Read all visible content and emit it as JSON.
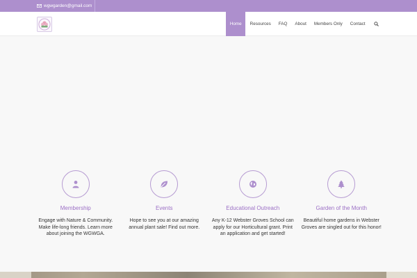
{
  "topbar": {
    "email": "wgwgarden@gmail.com",
    "icon": "mail-icon"
  },
  "header": {
    "logo_icon": "flower-logo",
    "nav": [
      {
        "label": "Home",
        "active": true
      },
      {
        "label": "Resources",
        "active": false
      },
      {
        "label": "FAQ",
        "active": false
      },
      {
        "label": "About",
        "active": false
      },
      {
        "label": "Members Only",
        "active": false
      },
      {
        "label": "Contact",
        "active": false
      }
    ],
    "search_icon": "search-icon"
  },
  "features": [
    {
      "icon": "user-icon",
      "title": "Membership",
      "description": "Engage with Nature & Community. Make life-long friends. Learn more about joining the WGWGA."
    },
    {
      "icon": "leaf-icon",
      "title": "Events",
      "description": "Hope to see you at our amazing annual plant sale! Find out more."
    },
    {
      "icon": "globe-icon",
      "title": "Educational Outreach",
      "description": "Any K-12 Webster Groves School can apply for our Horticultural grant. Print an application and get started!"
    },
    {
      "icon": "tree-icon",
      "title": "Garden of the Month",
      "description": "Beautiful home gardens in Webster Groves are singled out for this honor!"
    }
  ],
  "colors": {
    "accent": "#ad8fcd",
    "title": "#9b6fc5",
    "text": "#333333"
  }
}
